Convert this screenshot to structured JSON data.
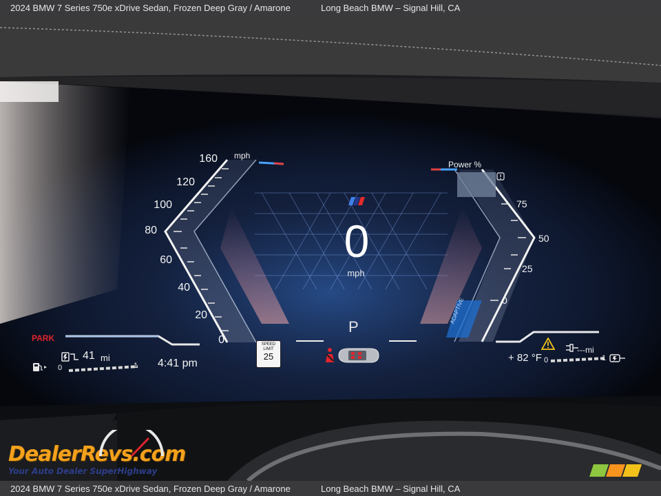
{
  "caption": {
    "vehicle": "2024 BMW 7 Series 750e xDrive Sedan,  Frozen Deep Gray / Amarone",
    "dealer": "Long Beach BMW – Signal Hill, CA"
  },
  "speedometer": {
    "unit_label": "mph",
    "ticks": [
      "160",
      "120",
      "100",
      "80",
      "60",
      "40",
      "20",
      "0"
    ],
    "current_speed": "0",
    "current_unit": "mph"
  },
  "power_gauge": {
    "label": "Power %",
    "ticks": [
      "75",
      "50",
      "25",
      "0"
    ],
    "mode_label": "ADAPTIVE"
  },
  "drive": {
    "gear": "P",
    "park_indicator": "PARK",
    "speed_limit_label": "SPEED\nLIMIT",
    "speed_limit_value": "25"
  },
  "status": {
    "range_value": "41",
    "range_unit": "mi",
    "time": "4:41 pm",
    "outside_temp": "+ 82 °F",
    "fuel_scale_min": "0",
    "fuel_scale_max": "1",
    "battery_scale_min": "0",
    "battery_scale_max": "1",
    "ev_range_unit": "---mi"
  },
  "icons": {
    "bmw_m_stripes": "bmw-m-stripes-icon",
    "fuel": "fuel-pump-icon",
    "charge": "ev-charge-icon",
    "warning": "warning-triangle-icon",
    "seatbelt": "seatbelt-icon",
    "car_top": "car-topview-icon",
    "plug": "plug-icon",
    "info": "info-icon"
  },
  "colors": {
    "accent_blue": "#2d8cff",
    "park_red": "#e0242c",
    "warning_yellow": "#f2c21a",
    "gauge_white": "#f4f4f4"
  },
  "watermark": {
    "brand": "DealerRevs.com",
    "tagline": "Your Auto Dealer SuperHighway"
  }
}
